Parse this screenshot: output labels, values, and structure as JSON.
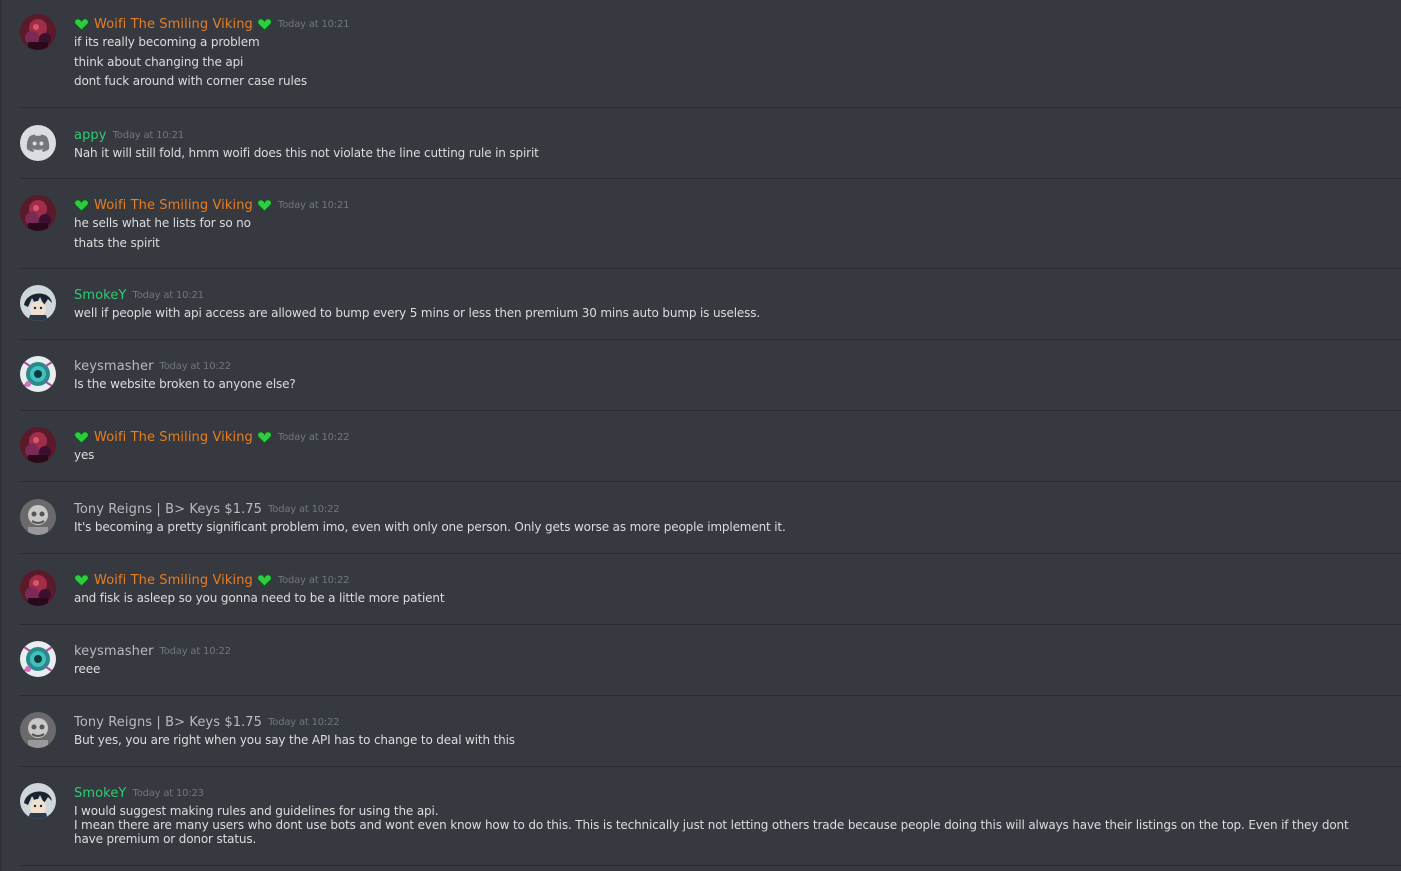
{
  "colors": {
    "background": "#36393f",
    "text": "#dcddde",
    "timestamp": "#72767d",
    "orange_role": "#e67e22",
    "green_role": "#2ecc71",
    "default_name": "#b9bbbe",
    "heart": "#2ecc40",
    "discord_blurple": "#7289da"
  },
  "messages": [
    {
      "author": "Woifi The Smiling Viking",
      "timestamp": "Today at 10:21",
      "lines": [
        "if its really becoming a problem",
        "think about changing the api",
        "dont fuck around with corner case rules"
      ]
    },
    {
      "author": "appy",
      "timestamp": "Today at 10:21",
      "lines": [
        "Nah it will still fold, hmm woifi does this not violate the line cutting rule in spirit"
      ]
    },
    {
      "author": "Woifi The Smiling Viking",
      "timestamp": "Today at 10:21",
      "lines": [
        "he sells what he lists for so no",
        "thats the spirit"
      ]
    },
    {
      "author": "SmokeY",
      "timestamp": "Today at 10:21",
      "lines": [
        "well if people with api access are allowed to bump every 5 mins or less then premium 30 mins auto bump is useless."
      ]
    },
    {
      "author": "keysmasher",
      "timestamp": "Today at 10:22",
      "lines": [
        "Is the website broken to anyone else?"
      ]
    },
    {
      "author": "Woifi The Smiling Viking",
      "timestamp": "Today at 10:22",
      "lines": [
        "yes"
      ]
    },
    {
      "author": "Tony Reigns | B> Keys $1.75",
      "timestamp": "Today at 10:22",
      "lines": [
        "It's becoming a pretty significant problem imo, even with only one person. Only gets worse as more people implement it."
      ]
    },
    {
      "author": "Woifi The Smiling Viking",
      "timestamp": "Today at 10:22",
      "lines": [
        "and fisk is asleep so you gonna need to be a little more patient"
      ]
    },
    {
      "author": "keysmasher",
      "timestamp": "Today at 10:22",
      "lines": [
        "reee"
      ]
    },
    {
      "author": "Tony Reigns | B> Keys $1.75",
      "timestamp": "Today at 10:22",
      "lines": [
        "But yes, you are right when you say the API has to change to deal with this"
      ]
    },
    {
      "author": "SmokeY",
      "timestamp": "Today at 10:23",
      "lines": [
        "I would suggest making rules and guidelines for using the api.",
        "I mean there are many users who dont use bots and wont even know how to do this. This is technically just not letting others trade because people doing this will always have their listings on the top. Even if they dont have premium or donor status."
      ]
    }
  ]
}
